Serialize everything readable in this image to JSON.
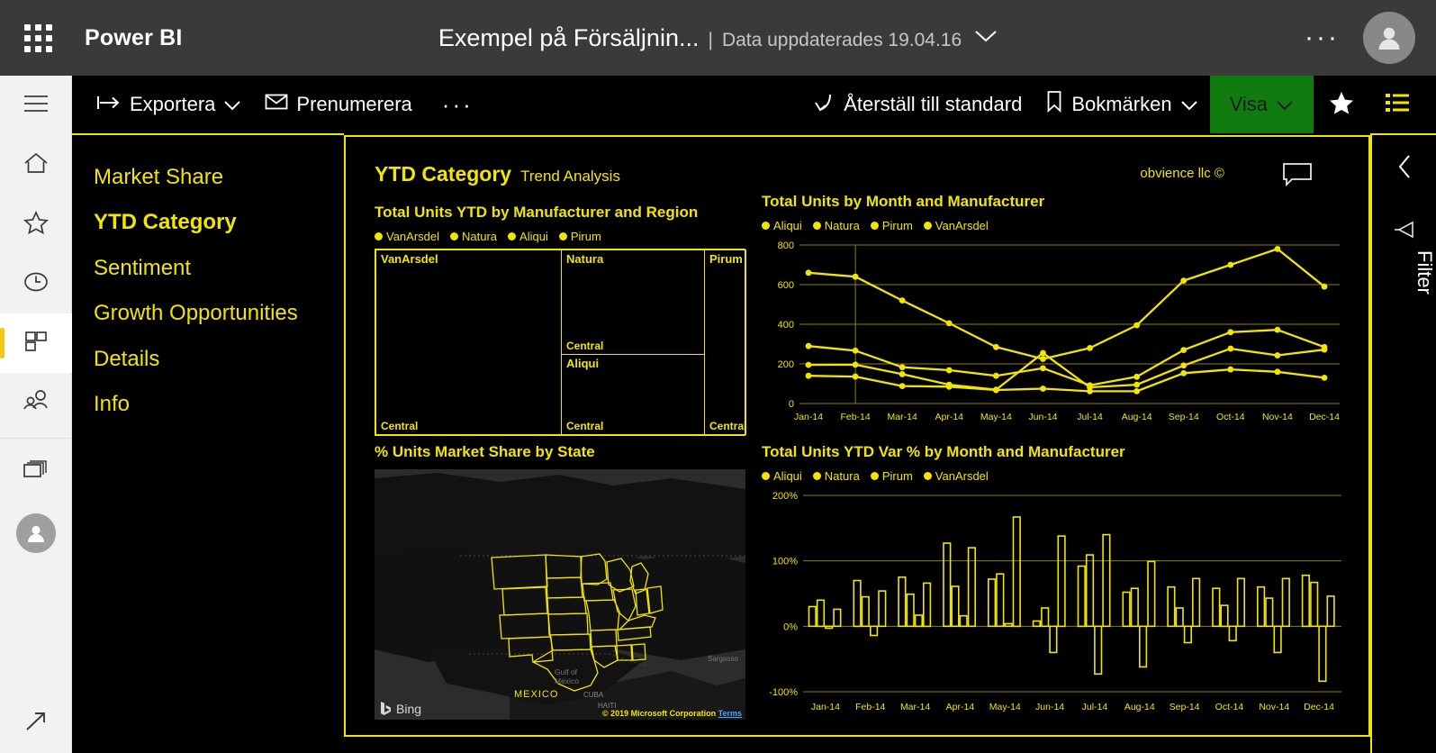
{
  "header": {
    "brand": "Power BI",
    "report_title": "Exempel på Försäljnin...",
    "separator": "|",
    "refresh_text": "Data uppdaterades 19.04.16",
    "waffle_icon": "app-launcher-icon",
    "chevron_icon": "chevron-down-icon",
    "more_icon": "ellipsis-icon",
    "avatar_icon": "user-avatar-icon"
  },
  "toolbar": {
    "export_label": "Exportera",
    "export_icon": "export-icon",
    "subscribe_label": "Prenumerera",
    "subscribe_icon": "envelope-icon",
    "more_label": "···",
    "reset_label": "Återställ till standard",
    "reset_icon": "undo-icon",
    "bookmarks_label": "Bokmärken",
    "bookmarks_icon": "bookmark-icon",
    "view_label": "Visa",
    "view_bg": "#107c10",
    "favorite_icon": "star-filled-icon",
    "list_icon": "list-view-icon",
    "chevron_icon": "chevron-down-icon"
  },
  "rail": {
    "items": [
      {
        "name": "hamburger",
        "icon": "hamburger-menu-icon",
        "selected": false
      },
      {
        "name": "home",
        "icon": "home-icon",
        "selected": false
      },
      {
        "name": "favorites",
        "icon": "star-outline-icon",
        "selected": false
      },
      {
        "name": "recent",
        "icon": "clock-icon",
        "selected": false
      },
      {
        "name": "apps",
        "icon": "apps-grid-icon",
        "selected": true
      },
      {
        "name": "shared",
        "icon": "people-icon",
        "selected": false
      },
      {
        "name": "workspaces",
        "icon": "workspaces-stack-icon",
        "selected": false
      },
      {
        "name": "my-workspace",
        "icon": "user-avatar-icon",
        "selected": false
      }
    ],
    "bottom_icon": "arrow-up-right-icon"
  },
  "page_nav": {
    "pages": [
      {
        "label": "Market Share",
        "selected": false
      },
      {
        "label": "YTD Category",
        "selected": true
      },
      {
        "label": "Sentiment",
        "selected": false
      },
      {
        "label": "Growth Opportunities",
        "selected": false
      },
      {
        "label": "Details",
        "selected": false
      },
      {
        "label": "Info",
        "selected": false
      }
    ]
  },
  "filter_pane": {
    "expand_icon": "chevron-left-icon",
    "funnel_icon": "filter-funnel-icon",
    "label": "Filter"
  },
  "report": {
    "title": "YTD Category",
    "subtitle": "Trend Analysis",
    "watermark": "obvience llc ©",
    "comment_icon": "comment-bubble-icon"
  },
  "accent": {
    "yellow": "#f2e600",
    "grid": "#8a8000",
    "green": "#107c10",
    "dark": "#000000",
    "header_bg": "#3b3a39"
  },
  "chart_data": [
    {
      "id": "treemap",
      "type": "treemap",
      "title": "Total Units YTD by Manufacturer and Region",
      "legend": [
        "VanArsdel",
        "Natura",
        "Aliqui",
        "Pirum"
      ],
      "legend_position": "top",
      "nodes": [
        {
          "manufacturer": "VanArsdel",
          "region": "Central",
          "value": 52
        },
        {
          "manufacturer": "Natura",
          "region": "Central",
          "value": 17
        },
        {
          "manufacturer": "Aliqui",
          "region": "Central",
          "value": 16
        },
        {
          "manufacturer": "Pirum",
          "region": "Central",
          "value": 9
        }
      ]
    },
    {
      "id": "map",
      "type": "map",
      "title": "% Units Market Share by State",
      "provider": "Bing",
      "attribution": "© 2019 Microsoft Corporation",
      "terms_label": "Terms",
      "region_labels": [
        "MEXICO",
        "Gulf of Mexico",
        "CUBA",
        "HAITI",
        "Sargasso"
      ],
      "highlighted_states": [
        "Montana",
        "Wyoming",
        "Colorado",
        "New Mexico",
        "North Dakota",
        "South Dakota",
        "Nebraska",
        "Kansas",
        "Oklahoma",
        "Texas",
        "Minnesota",
        "Iowa",
        "Missouri",
        "Arkansas",
        "Louisiana",
        "Wisconsin",
        "Illinois",
        "Mississippi",
        "Tennessee",
        "Kentucky",
        "Michigan",
        "Indiana",
        "Ohio"
      ]
    },
    {
      "id": "line_total_units",
      "type": "line",
      "title": "Total Units by Month and Manufacturer",
      "legend": [
        "Aliqui",
        "Natura",
        "Pirum",
        "VanArsdel"
      ],
      "legend_position": "top",
      "xlabel": "",
      "ylabel": "",
      "categories": [
        "Jan-14",
        "Feb-14",
        "Mar-14",
        "Apr-14",
        "May-14",
        "Jun-14",
        "Jul-14",
        "Aug-14",
        "Sep-14",
        "Oct-14",
        "Nov-14",
        "Dec-14"
      ],
      "yticks": [
        0,
        200,
        400,
        600,
        800
      ],
      "ylim": [
        0,
        800
      ],
      "ytick_labels": [
        "0",
        "200",
        "400",
        "600",
        "800"
      ],
      "grid": true,
      "series": [
        {
          "name": "VanArsdel",
          "values": [
            660,
            640,
            520,
            405,
            285,
            225,
            280,
            395,
            620,
            700,
            780,
            590
          ]
        },
        {
          "name": "Aliqui",
          "values": [
            290,
            267,
            183,
            168,
            140,
            178,
            92,
            135,
            270,
            360,
            372,
            285
          ]
        },
        {
          "name": "Natura",
          "values": [
            195,
            196,
            148,
            95,
            70,
            255,
            82,
            95,
            192,
            277,
            243,
            272
          ]
        },
        {
          "name": "Pirum",
          "values": [
            140,
            136,
            88,
            85,
            68,
            75,
            62,
            62,
            153,
            172,
            160,
            130
          ]
        }
      ]
    },
    {
      "id": "bar_ytd_var",
      "type": "bar",
      "title": "Total Units YTD Var % by Month and Manufacturer",
      "legend": [
        "Aliqui",
        "Natura",
        "Pirum",
        "VanArsdel"
      ],
      "legend_position": "top",
      "xlabel": "",
      "ylabel": "",
      "categories": [
        "Jan-14",
        "Feb-14",
        "Mar-14",
        "Apr-14",
        "May-14",
        "Jun-14",
        "Jul-14",
        "Aug-14",
        "Sep-14",
        "Oct-14",
        "Nov-14",
        "Dec-14"
      ],
      "yticks": [
        -100,
        0,
        100,
        200
      ],
      "ytick_labels": [
        "-100%",
        "0%",
        "100%",
        "200%"
      ],
      "ylim": [
        -100,
        200
      ],
      "grid": true,
      "unit": "%",
      "series": [
        {
          "name": "Aliqui",
          "values": [
            30,
            70,
            75,
            127,
            72,
            8,
            92,
            52,
            60,
            58,
            60,
            78
          ]
        },
        {
          "name": "Natura",
          "values": [
            40,
            45,
            49,
            61,
            80,
            28,
            109,
            58,
            28,
            32,
            43,
            67
          ]
        },
        {
          "name": "Pirum",
          "values": [
            -3,
            -14,
            17,
            16,
            4,
            -40,
            -73,
            -62,
            -25,
            -22,
            -40,
            -84
          ]
        },
        {
          "name": "VanArsdel",
          "values": [
            26,
            54,
            66,
            120,
            167,
            138,
            140,
            99,
            73,
            73,
            73,
            46
          ]
        }
      ]
    }
  ]
}
